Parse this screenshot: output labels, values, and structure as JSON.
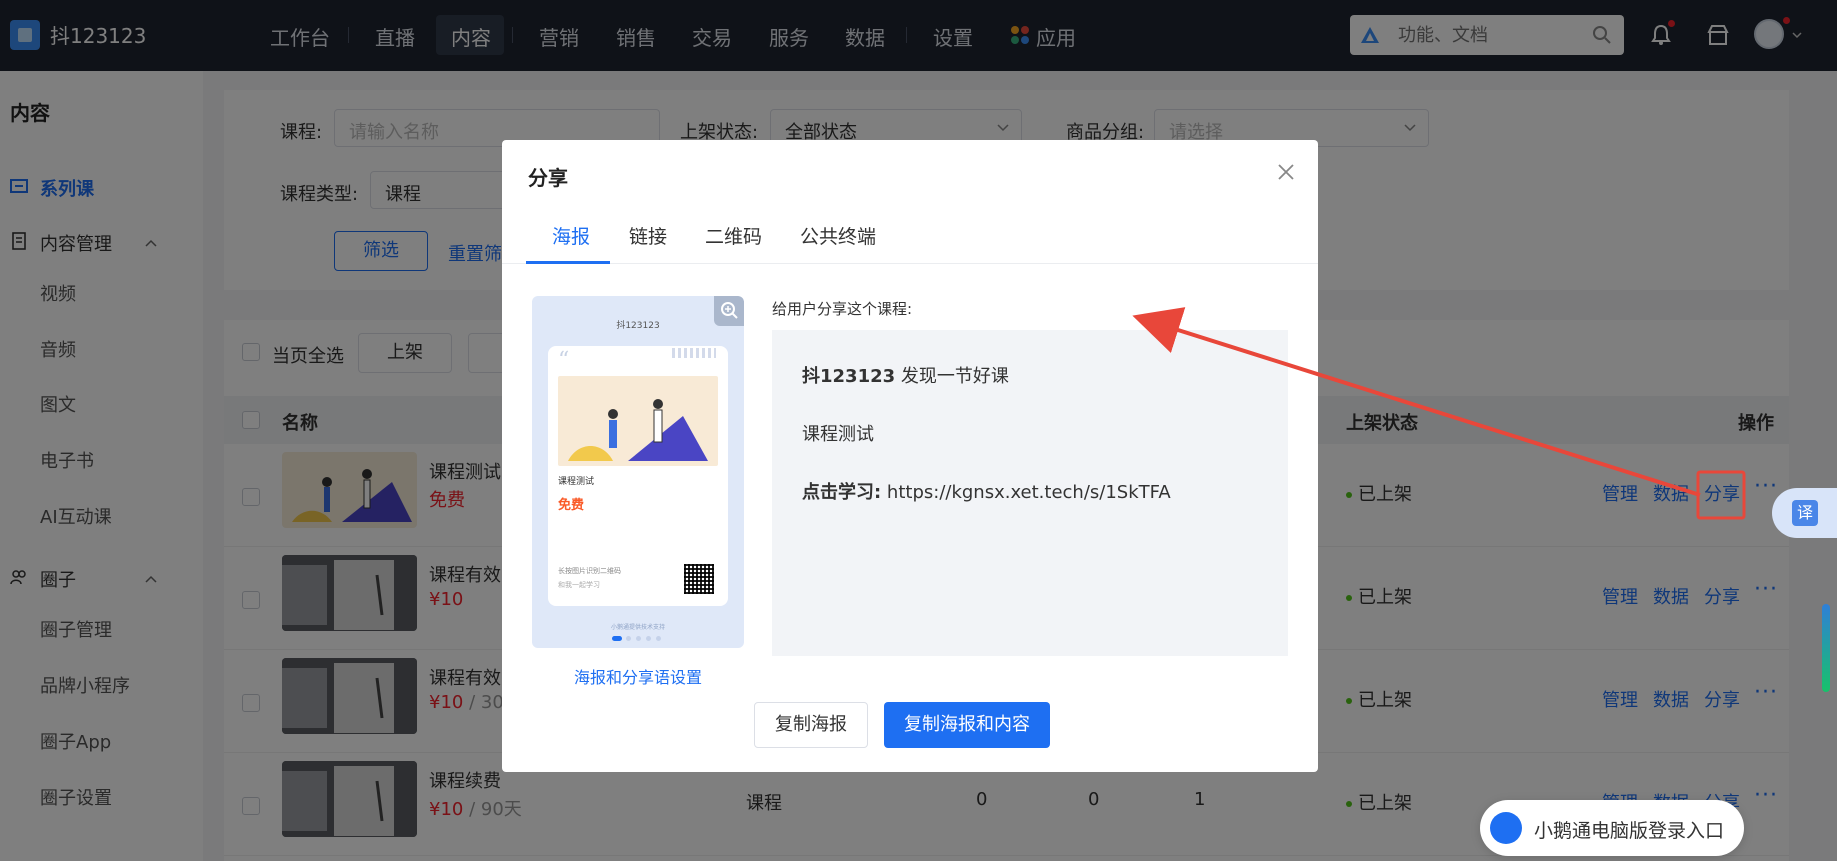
{
  "topbar": {
    "store_name": "抖123123",
    "nav": [
      "工作台",
      "直播",
      "内容",
      "营销",
      "销售",
      "交易",
      "服务",
      "数据",
      "设置",
      "应用"
    ],
    "search_placeholder": "功能、文档"
  },
  "sidebar": {
    "title": "内容",
    "items": [
      {
        "label": "系列课",
        "active": true
      },
      {
        "label": "内容管理"
      },
      {
        "label": "视频"
      },
      {
        "label": "音频"
      },
      {
        "label": "图文"
      },
      {
        "label": "电子书"
      },
      {
        "label": "AI互动课"
      },
      {
        "label": "圈子"
      },
      {
        "label": "圈子管理"
      },
      {
        "label": "品牌小程序"
      },
      {
        "label": "圈子App"
      },
      {
        "label": "圈子设置"
      }
    ]
  },
  "filters": {
    "course_label": "课程:",
    "course_placeholder": "请输入名称",
    "status_label": "上架状态:",
    "status_value": "全部状态",
    "group_label": "商品分组:",
    "group_placeholder": "请选择",
    "type_label": "课程类型:",
    "type_value": "课程",
    "filter_button": "筛选",
    "reset_link": "重置筛"
  },
  "toolbar": {
    "select_all": "当页全选",
    "on_shelf": "上架"
  },
  "table": {
    "headers": {
      "name": "名称",
      "status": "上架状态",
      "ops": "操作"
    },
    "rows": [
      {
        "title": "课程测试",
        "price": "免费",
        "suffix": "",
        "type": "",
        "c1": "",
        "c2": "",
        "c3": "",
        "status": "已上架"
      },
      {
        "title": "课程有效",
        "price": "¥10",
        "suffix": "",
        "type": "",
        "c1": "",
        "c2": "",
        "c3": "",
        "status": "已上架"
      },
      {
        "title": "课程有效",
        "price": "¥10",
        "suffix": " / 30",
        "type": "",
        "c1": "",
        "c2": "",
        "c3": "",
        "status": "已上架"
      },
      {
        "title": "课程续费",
        "price": "¥10",
        "suffix": " / 90天",
        "type": "课程",
        "c1": "0",
        "c2": "0",
        "c3": "1",
        "status": "已上架"
      }
    ],
    "ops": {
      "manage": "管理",
      "data": "数据",
      "share": "分享",
      "more": "···"
    }
  },
  "modal": {
    "title": "分享",
    "tabs": [
      "海报",
      "链接",
      "二维码",
      "公共终端"
    ],
    "share_label": "给用户分享这个课程:",
    "share_lines": {
      "brand": "抖123123",
      "brand_suffix": " 发现一节好课",
      "course": "课程测试",
      "learn_label": "点击学习:",
      "learn_url": " https://kgnsx.xet.tech/s/1SkTFA"
    },
    "poster": {
      "brand": "抖123123",
      "course": "课程测试",
      "price": "免费",
      "hint1": "长按图片识别二维码",
      "hint2": "和我一起学习",
      "footer": "小鹅通提供技术支持"
    },
    "poster_settings_link": "海报和分享语设置",
    "copy_poster": "复制海报",
    "copy_all": "复制海报和内容"
  },
  "fab": {
    "translate": "译"
  },
  "login_pill": "小鹅通电脑版登录入口",
  "colors": {
    "accent": "#1e6ff2",
    "price": "#f5222d",
    "annotation": "#e8473a"
  }
}
